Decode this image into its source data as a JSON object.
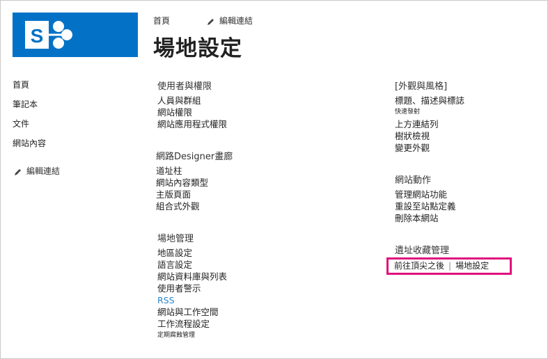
{
  "header": {
    "home_link": "首頁",
    "edit_links": "編輯連結",
    "page_title": "場地設定"
  },
  "left_nav": {
    "items": [
      "首頁",
      "筆記本",
      "文件",
      "網站內容"
    ],
    "edit_links": "編輯連結"
  },
  "sections": {
    "users": {
      "title": "使用者與權限",
      "links": [
        "人員與群組",
        "網站權限",
        "網站應用程式權限"
      ]
    },
    "designer": {
      "title": "網路Designer畫廊",
      "links": [
        "道址柱",
        "網站內容類型",
        "主版頁面",
        "組合式外觀"
      ]
    },
    "site_admin": {
      "title": "場地管理",
      "links": [
        "地區設定",
        "語言設定",
        "網站資料庫與列表",
        "使用者警示",
        "RSS",
        "網站與工作空間",
        "工作流程設定",
        "定期腐蝕管理"
      ]
    },
    "look": {
      "title": "[外觀與風格]",
      "links": [
        "標題、描述與標誌",
        "快速發射",
        "上方連結列",
        "樹狀檢視",
        "變更外觀"
      ]
    },
    "actions": {
      "title": "網站動作",
      "links": [
        "管理網站功能",
        "重設至站點定義",
        "刪除本網站"
      ]
    },
    "collection": {
      "title": "遺址收藏管理",
      "link_a": "前往頂尖之後",
      "link_b": "場地設定"
    }
  }
}
